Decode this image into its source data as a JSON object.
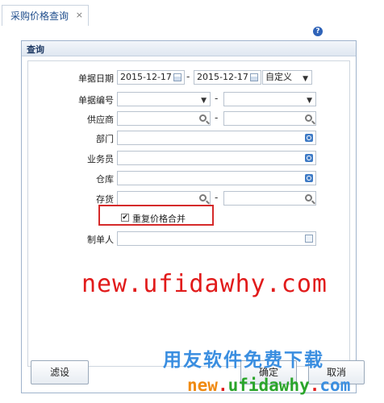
{
  "tab": {
    "label": "采购价格查询",
    "close": "×"
  },
  "dialog": {
    "title": "查询",
    "help": "?",
    "fields": {
      "doc_date": {
        "label": "单据日期",
        "from": "2015-12-17",
        "to": "2015-12-17",
        "range_option": "自定义"
      },
      "doc_no": {
        "label": "单据编号"
      },
      "supplier": {
        "label": "供应商"
      },
      "department": {
        "label": "部门"
      },
      "salesperson": {
        "label": "业务员"
      },
      "warehouse": {
        "label": "仓库"
      },
      "inventory": {
        "label": "存货"
      },
      "merge_repeat": {
        "label": "重复价格合并",
        "checked": true
      },
      "creator": {
        "label": "制单人"
      }
    },
    "range_sep": "-",
    "buttons": {
      "filter": "滤设",
      "ok": "确定",
      "cancel": "取消"
    }
  },
  "watermark": {
    "url_red": "new.ufidawhy.com",
    "slogan": "用友软件免费下载",
    "url_color": {
      "new": "new",
      "dot1": ".",
      "ufida": "ufidawhy",
      "dot2": ".",
      "com": "com"
    }
  },
  "colors": {
    "highlight_border": "#d52a2a",
    "watermark_red": "#e11b1b",
    "watermark_blue": "#3a8ee0",
    "wm_orange": "#f08a12",
    "wm_green": "#2aa52a"
  }
}
